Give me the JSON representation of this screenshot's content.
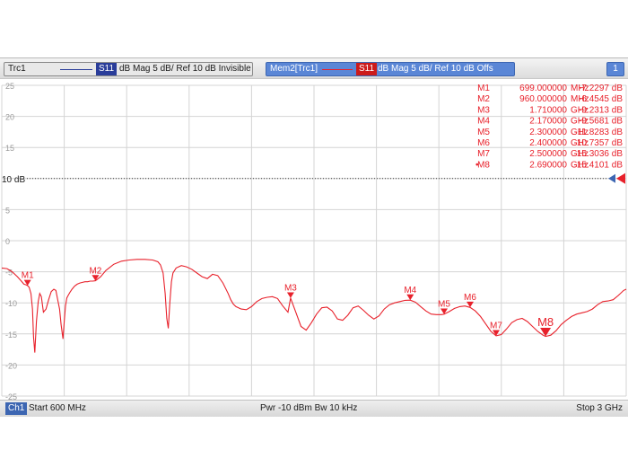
{
  "traces": {
    "trc1": {
      "name": "Trc1",
      "param": "S11",
      "format": "dB Mag  5 dB/ Ref 10 dB  Invisible",
      "line_color": "#2a3d9a",
      "param_bg": "#2a3d9a"
    },
    "mem2": {
      "name": "Mem2[Trc1]",
      "param": "S11",
      "format": "dB Mag  5 dB/ Ref 10 dB  Offs",
      "line_color": "#e8212b",
      "param_bg": "#cc1b1b"
    }
  },
  "info_button": "1",
  "ref_label": "10 dB",
  "status": {
    "channel": "Ch1",
    "start": "Start  600 MHz",
    "mid": "Pwr  -10 dBm  Bw  10 kHz",
    "stop": "Stop  3 GHz"
  },
  "markers": [
    {
      "name": "M1",
      "freq": "699.000000",
      "unit": "MHz",
      "value": "-7.2297 dB"
    },
    {
      "name": "M2",
      "freq": "960.000000",
      "unit": "MHz",
      "value": "-6.4545 dB"
    },
    {
      "name": "M3",
      "freq": "1.710000",
      "unit": "GHz",
      "value": "-9.2313 dB"
    },
    {
      "name": "M4",
      "freq": "2.170000",
      "unit": "GHz",
      "value": "-9.5681 dB"
    },
    {
      "name": "M5",
      "freq": "2.300000",
      "unit": "GHz",
      "value": "-11.8283 dB"
    },
    {
      "name": "M6",
      "freq": "2.400000",
      "unit": "GHz",
      "value": "-10.7357 dB"
    },
    {
      "name": "M7",
      "freq": "2.500000",
      "unit": "GHz",
      "value": "-15.3036 dB"
    },
    {
      "name": "M8",
      "freq": "2.690000",
      "unit": "GHz",
      "value": "-15.4101 dB",
      "active": true
    }
  ],
  "chart_data": {
    "type": "line",
    "title": "",
    "xlabel": "",
    "ylabel": "",
    "x_unit": "MHz",
    "xlim": [
      600,
      3000
    ],
    "ylim": [
      -25,
      25
    ],
    "y_ticks": [
      25,
      20,
      15,
      10,
      5,
      0,
      -5,
      -10,
      -15,
      -20,
      -25
    ],
    "grid": true,
    "reference_level_db": 10,
    "series": [
      {
        "name": "Mem2[Trc1]",
        "color": "#e8212b",
        "x": [
          600,
          620,
          640,
          660,
          675,
          685,
          693,
          699,
          705,
          712,
          718,
          722,
          727,
          733,
          740,
          746,
          752,
          760,
          770,
          780,
          790,
          800,
          808,
          815,
          822,
          828,
          835,
          840,
          845,
          850,
          855,
          862,
          870,
          880,
          890,
          900,
          910,
          920,
          930,
          940,
          950,
          960,
          980,
          1000,
          1030,
          1060,
          1090,
          1120,
          1150,
          1180,
          1200,
          1210,
          1220,
          1228,
          1234,
          1240,
          1246,
          1252,
          1258,
          1270,
          1290,
          1310,
          1330,
          1350,
          1370,
          1390,
          1410,
          1430,
          1450,
          1470,
          1480,
          1490,
          1500,
          1520,
          1540,
          1560,
          1580,
          1600,
          1620,
          1640,
          1660,
          1680,
          1700,
          1710,
          1730,
          1750,
          1770,
          1790,
          1810,
          1830,
          1850,
          1870,
          1890,
          1910,
          1930,
          1950,
          1970,
          1990,
          2010,
          2030,
          2050,
          2070,
          2090,
          2110,
          2130,
          2150,
          2170,
          2190,
          2210,
          2230,
          2250,
          2270,
          2290,
          2300,
          2320,
          2340,
          2360,
          2380,
          2400,
          2420,
          2440,
          2460,
          2480,
          2500,
          2520,
          2540,
          2560,
          2580,
          2600,
          2620,
          2640,
          2660,
          2680,
          2690,
          2710,
          2730,
          2750,
          2770,
          2790,
          2810,
          2830,
          2850,
          2870,
          2890,
          2910,
          2930,
          2950,
          2970,
          2990,
          3000
        ],
        "y": [
          -4.4,
          -4.5,
          -5.0,
          -5.8,
          -6.5,
          -7.0,
          -7.1,
          -7.23,
          -7.5,
          -8.5,
          -11,
          -15.5,
          -18,
          -13,
          -9.8,
          -8.5,
          -9,
          -11.5,
          -11,
          -9.5,
          -8.2,
          -7.8,
          -8,
          -9.5,
          -11,
          -13.5,
          -15.8,
          -13,
          -10.5,
          -9.2,
          -8.8,
          -8.3,
          -7.8,
          -7.3,
          -7.0,
          -6.8,
          -6.7,
          -6.6,
          -6.6,
          -6.5,
          -6.5,
          -6.45,
          -5.8,
          -4.8,
          -3.8,
          -3.3,
          -3.1,
          -3.0,
          -3.0,
          -3.1,
          -3.4,
          -3.9,
          -5.2,
          -8.5,
          -12.5,
          -14.1,
          -10,
          -6.6,
          -5.2,
          -4.4,
          -4.0,
          -4.2,
          -4.6,
          -5.2,
          -5.8,
          -6.1,
          -5.4,
          -5.6,
          -6.8,
          -8.5,
          -9.5,
          -10.2,
          -10.6,
          -11.0,
          -11.1,
          -10.6,
          -9.8,
          -9.3,
          -9.1,
          -9.0,
          -9.3,
          -10.5,
          -11.5,
          -9.23,
          -11.5,
          -13.8,
          -14.4,
          -13.2,
          -11.8,
          -10.8,
          -10.7,
          -11.3,
          -12.6,
          -12.8,
          -12.0,
          -10.8,
          -10.5,
          -11.2,
          -12.0,
          -12.6,
          -12.1,
          -11.0,
          -10.3,
          -10.0,
          -9.8,
          -9.6,
          -9.57,
          -9.9,
          -10.6,
          -11.3,
          -11.8,
          -11.9,
          -11.9,
          -11.83,
          -11.4,
          -10.9,
          -10.6,
          -10.5,
          -10.74,
          -11.3,
          -12.2,
          -13.4,
          -14.6,
          -15.3,
          -15.1,
          -14.2,
          -13.2,
          -12.7,
          -12.5,
          -13.0,
          -13.8,
          -14.6,
          -15.2,
          -15.41,
          -15.2,
          -14.5,
          -13.5,
          -12.8,
          -12.2,
          -11.8,
          -11.6,
          -11.4,
          -11.0,
          -10.3,
          -9.8,
          -9.7,
          -9.5,
          -8.8,
          -8.0,
          -7.8
        ]
      }
    ],
    "markers": [
      {
        "name": "M1",
        "x": 699,
        "y": -7.2297
      },
      {
        "name": "M2",
        "x": 960,
        "y": -6.4545
      },
      {
        "name": "M3",
        "x": 1710,
        "y": -9.2313
      },
      {
        "name": "M4",
        "x": 2170,
        "y": -9.5681
      },
      {
        "name": "M5",
        "x": 2300,
        "y": -11.8283
      },
      {
        "name": "M6",
        "x": 2400,
        "y": -10.7357
      },
      {
        "name": "M7",
        "x": 2500,
        "y": -15.3036
      },
      {
        "name": "M8",
        "x": 2690,
        "y": -15.4101
      }
    ]
  }
}
